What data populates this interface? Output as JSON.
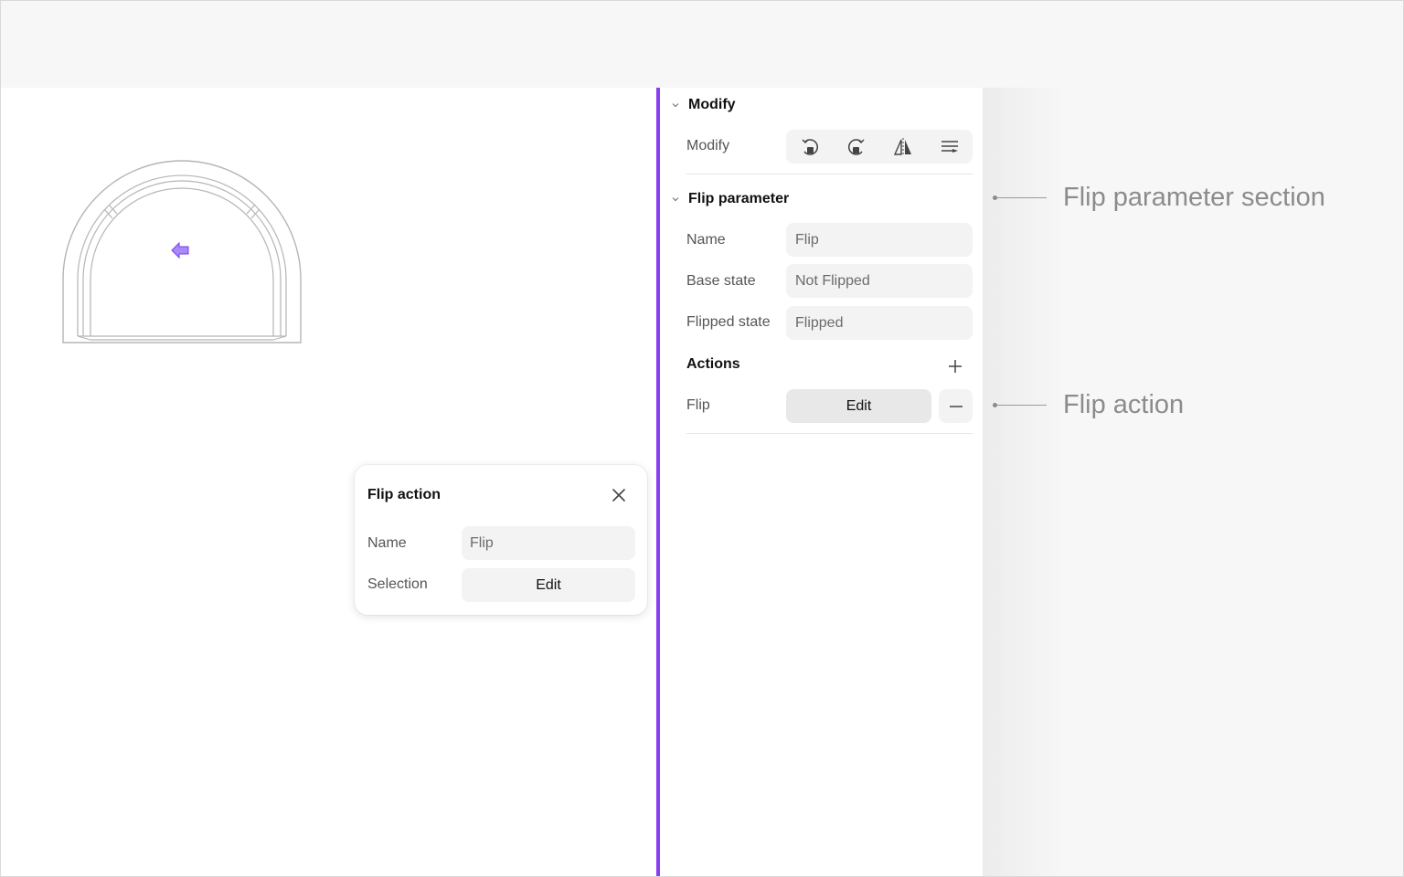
{
  "panel": {
    "modify_section": {
      "title": "Modify",
      "row_label": "Modify",
      "tools": [
        "rotate-left-icon",
        "rotate-right-icon",
        "flip-horizontal-icon",
        "align-icon"
      ]
    },
    "flip_parameter": {
      "title": "Flip parameter",
      "name_label": "Name",
      "name_value": "Flip",
      "base_state_label": "Base state",
      "base_state_value": "Not Flipped",
      "flipped_state_label": "Flipped state",
      "flipped_state_value": "Flipped"
    },
    "actions": {
      "title": "Actions",
      "items": [
        {
          "label": "Flip",
          "button": "Edit"
        }
      ]
    }
  },
  "popup": {
    "title": "Flip action",
    "name_label": "Name",
    "name_value": "Flip",
    "selection_label": "Selection",
    "selection_button": "Edit"
  },
  "callouts": {
    "flip_parameter_section": "Flip parameter section",
    "flip_action": "Flip action"
  },
  "colors": {
    "accent": "#8a3ff0",
    "background": "#f7f7f7",
    "field": "#f3f3f3",
    "callout_text": "#8c8c8c"
  }
}
